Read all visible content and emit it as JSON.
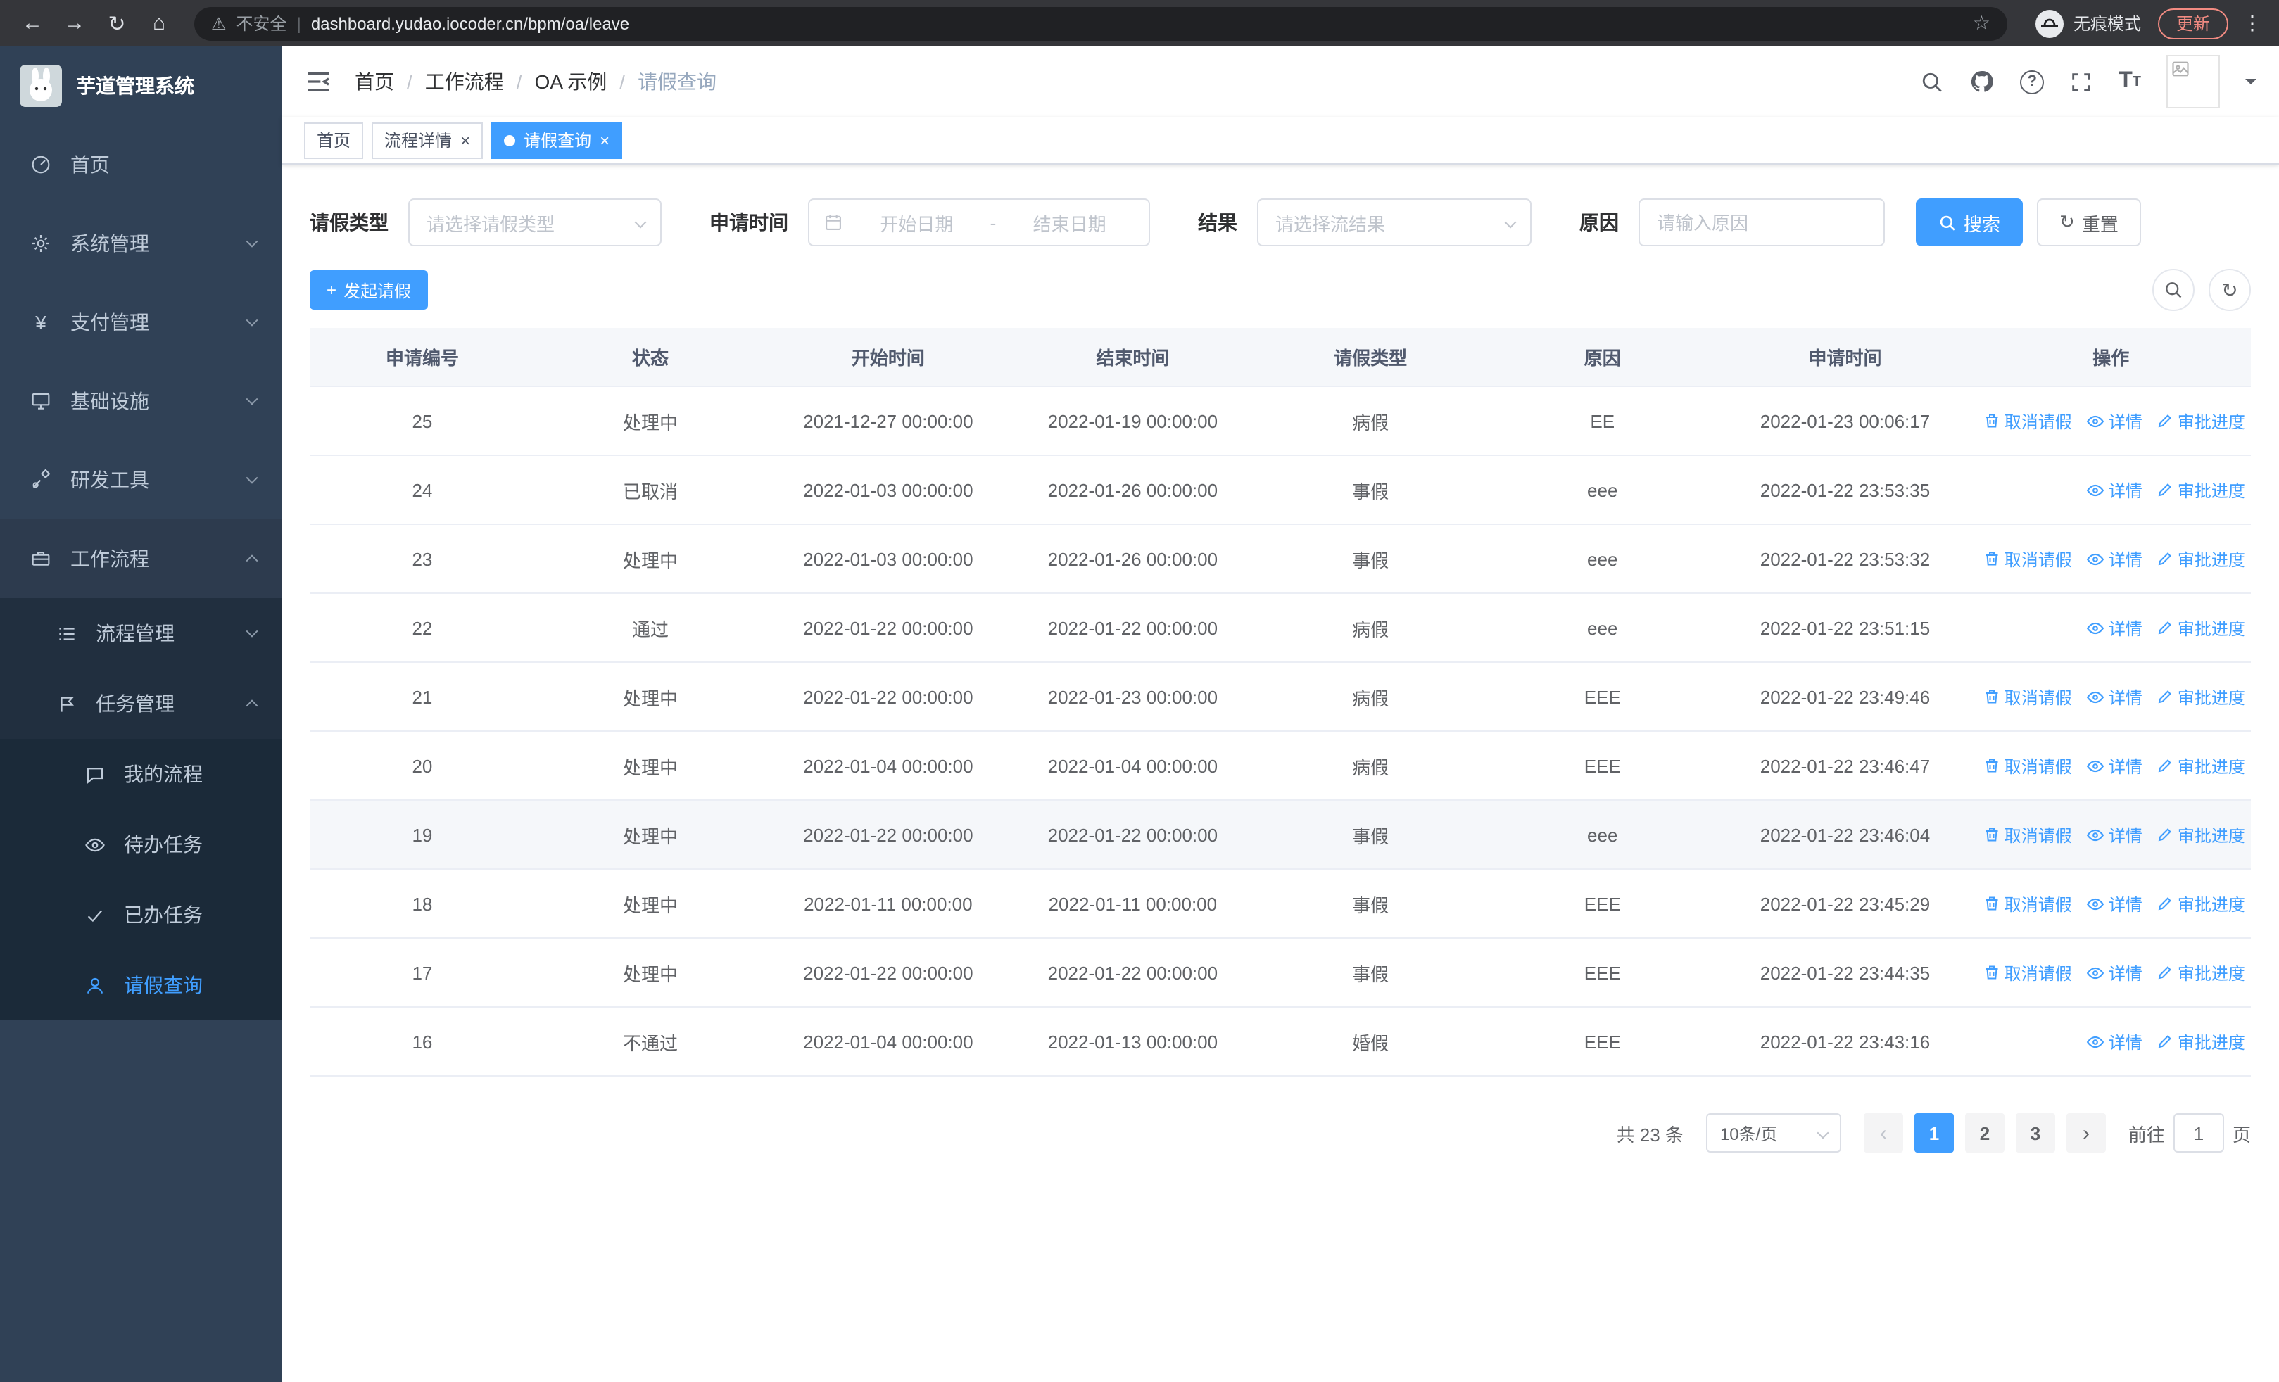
{
  "browser": {
    "security_label": "不安全",
    "url": "dashboard.yudao.iocoder.cn/bpm/oa/leave",
    "incognito_label": "无痕模式",
    "update_label": "更新"
  },
  "icons": {
    "back": "←",
    "forward": "→",
    "reload": "↻",
    "home": "⌂",
    "warning": "⚠",
    "star": "☆",
    "menu_kebab": "⋮",
    "pipe": "|",
    "close": "×",
    "plus": "+",
    "yen": "¥",
    "question": "?",
    "refresh": "↻",
    "page_prev": "‹",
    "page_next": "›",
    "font_size_big": "T",
    "font_size_small": "T"
  },
  "sidebar": {
    "logo_title": "芋道管理系统",
    "items": [
      {
        "label": "首页"
      },
      {
        "label": "系统管理"
      },
      {
        "label": "支付管理"
      },
      {
        "label": "基础设施"
      },
      {
        "label": "研发工具"
      },
      {
        "label": "工作流程"
      },
      {
        "label": "流程管理"
      },
      {
        "label": "任务管理"
      },
      {
        "label": "我的流程"
      },
      {
        "label": "待办任务"
      },
      {
        "label": "已办任务"
      },
      {
        "label": "请假查询"
      }
    ]
  },
  "breadcrumb": [
    "首页",
    "工作流程",
    "OA 示例",
    "请假查询"
  ],
  "tabs": [
    {
      "label": "首页"
    },
    {
      "label": "流程详情"
    },
    {
      "label": "请假查询"
    }
  ],
  "filters": {
    "leave_type_label": "请假类型",
    "leave_type_placeholder": "请选择请假类型",
    "apply_time_label": "申请时间",
    "start_date_placeholder": "开始日期",
    "range_separator": "-",
    "end_date_placeholder": "结束日期",
    "result_label": "结果",
    "result_placeholder": "请选择流结果",
    "reason_label": "原因",
    "reason_placeholder": "请输入原因",
    "search_label": "搜索",
    "reset_label": "重置"
  },
  "toolbar": {
    "create_label": "发起请假"
  },
  "table": {
    "headers": [
      "申请编号",
      "状态",
      "开始时间",
      "结束时间",
      "请假类型",
      "原因",
      "申请时间",
      "操作"
    ],
    "action_labels": {
      "cancel": "取消请假",
      "detail": "详情",
      "progress": "审批进度"
    },
    "rows": [
      {
        "id": "25",
        "status": "处理中",
        "start": "2021-12-27 00:00:00",
        "end": "2022-01-19 00:00:00",
        "type": "病假",
        "reason": "EE",
        "applied": "2022-01-23 00:06:17",
        "actions": [
          "cancel",
          "detail",
          "progress"
        ]
      },
      {
        "id": "24",
        "status": "已取消",
        "start": "2022-01-03 00:00:00",
        "end": "2022-01-26 00:00:00",
        "type": "事假",
        "reason": "eee",
        "applied": "2022-01-22 23:53:35",
        "actions": [
          "detail",
          "progress"
        ]
      },
      {
        "id": "23",
        "status": "处理中",
        "start": "2022-01-03 00:00:00",
        "end": "2022-01-26 00:00:00",
        "type": "事假",
        "reason": "eee",
        "applied": "2022-01-22 23:53:32",
        "actions": [
          "cancel",
          "detail",
          "progress"
        ]
      },
      {
        "id": "22",
        "status": "通过",
        "start": "2022-01-22 00:00:00",
        "end": "2022-01-22 00:00:00",
        "type": "病假",
        "reason": "eee",
        "applied": "2022-01-22 23:51:15",
        "actions": [
          "detail",
          "progress"
        ]
      },
      {
        "id": "21",
        "status": "处理中",
        "start": "2022-01-22 00:00:00",
        "end": "2022-01-23 00:00:00",
        "type": "病假",
        "reason": "EEE",
        "applied": "2022-01-22 23:49:46",
        "actions": [
          "cancel",
          "detail",
          "progress"
        ]
      },
      {
        "id": "20",
        "status": "处理中",
        "start": "2022-01-04 00:00:00",
        "end": "2022-01-04 00:00:00",
        "type": "病假",
        "reason": "EEE",
        "applied": "2022-01-22 23:46:47",
        "actions": [
          "cancel",
          "detail",
          "progress"
        ]
      },
      {
        "id": "19",
        "status": "处理中",
        "start": "2022-01-22 00:00:00",
        "end": "2022-01-22 00:00:00",
        "type": "事假",
        "reason": "eee",
        "applied": "2022-01-22 23:46:04",
        "actions": [
          "cancel",
          "detail",
          "progress"
        ],
        "highlight": true
      },
      {
        "id": "18",
        "status": "处理中",
        "start": "2022-01-11 00:00:00",
        "end": "2022-01-11 00:00:00",
        "type": "事假",
        "reason": "EEE",
        "applied": "2022-01-22 23:45:29",
        "actions": [
          "cancel",
          "detail",
          "progress"
        ]
      },
      {
        "id": "17",
        "status": "处理中",
        "start": "2022-01-22 00:00:00",
        "end": "2022-01-22 00:00:00",
        "type": "事假",
        "reason": "EEE",
        "applied": "2022-01-22 23:44:35",
        "actions": [
          "cancel",
          "detail",
          "progress"
        ]
      },
      {
        "id": "16",
        "status": "不通过",
        "start": "2022-01-04 00:00:00",
        "end": "2022-01-13 00:00:00",
        "type": "婚假",
        "reason": "EEE",
        "applied": "2022-01-22 23:43:16",
        "actions": [
          "detail",
          "progress"
        ]
      }
    ]
  },
  "pagination": {
    "total_label": "共 23 条",
    "page_size_label": "10条/页",
    "pages": [
      "1",
      "2",
      "3"
    ],
    "active_page": "1",
    "goto_label": "前往",
    "goto_value": "1",
    "goto_suffix": "页"
  },
  "colors": {
    "accent": "#409eff",
    "sidebar_bg": "#304156"
  }
}
